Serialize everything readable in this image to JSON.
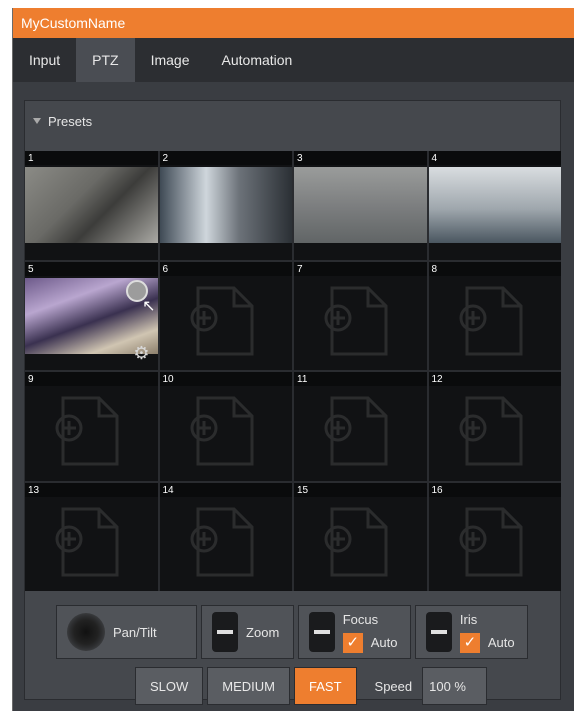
{
  "window": {
    "title": "MyCustomName"
  },
  "tabs": [
    {
      "label": "Input",
      "active": false
    },
    {
      "label": "PTZ",
      "active": true
    },
    {
      "label": "Image",
      "active": false
    },
    {
      "label": "Automation",
      "active": false
    }
  ],
  "presets": {
    "header": "Presets",
    "items": [
      {
        "number": "1",
        "has_image": true
      },
      {
        "number": "2",
        "has_image": true
      },
      {
        "number": "3",
        "has_image": true
      },
      {
        "number": "4",
        "has_image": true
      },
      {
        "number": "5",
        "has_image": true,
        "hovered": true
      },
      {
        "number": "6",
        "has_image": false
      },
      {
        "number": "7",
        "has_image": false
      },
      {
        "number": "8",
        "has_image": false
      },
      {
        "number": "9",
        "has_image": false
      },
      {
        "number": "10",
        "has_image": false
      },
      {
        "number": "11",
        "has_image": false
      },
      {
        "number": "12",
        "has_image": false
      },
      {
        "number": "13",
        "has_image": false
      },
      {
        "number": "14",
        "has_image": false
      },
      {
        "number": "15",
        "has_image": false
      },
      {
        "number": "16",
        "has_image": false
      }
    ]
  },
  "controls": {
    "pan_tilt": "Pan/Tilt",
    "zoom": "Zoom",
    "focus": "Focus",
    "focus_auto": "Auto",
    "iris": "Iris",
    "iris_auto": "Auto"
  },
  "speed": {
    "slow": "SLOW",
    "medium": "MEDIUM",
    "fast": "FAST",
    "label": "Speed",
    "value": "100 %",
    "selected": "FAST"
  },
  "colors": {
    "accent": "#ee7e2f",
    "panel": "#45484d",
    "tab_bar": "#2c2e32"
  }
}
